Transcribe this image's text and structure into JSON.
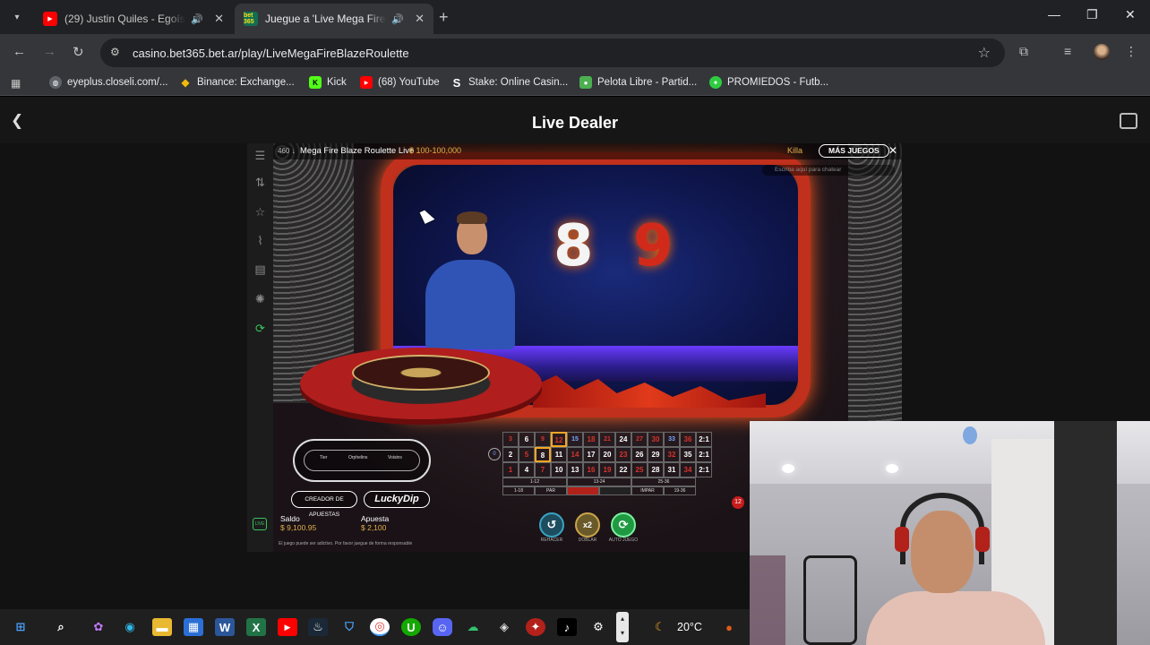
{
  "browser": {
    "tabs": [
      {
        "title": "(29) Justin Quiles - Egoísta (",
        "favicon": "youtube",
        "active": false
      },
      {
        "title": "Juegue a 'Live Mega Fire Bl",
        "favicon": "bet365",
        "favicon_text": "bet 365",
        "active": true
      }
    ],
    "url": "casino.bet365.bet.ar/play/LiveMegaFireBlazeRoulette",
    "bookmarks": [
      {
        "label": "eyeplus.closeli.com/...",
        "icon": "globe",
        "color": "#5f6368"
      },
      {
        "label": "Binance: Exchange...",
        "icon": "binance",
        "color": "#f0b90b"
      },
      {
        "label": "Kick",
        "icon": "kick",
        "icon_text": "K",
        "color": "#53fc18"
      },
      {
        "label": "(68) YouTube",
        "icon": "youtube",
        "color": "#ff0000"
      },
      {
        "label": "Stake: Online Casin...",
        "icon": "stake",
        "icon_text": "S",
        "color": "#1a2c38"
      },
      {
        "label": "Pelota Libre - Partid...",
        "icon": "pelota-libre",
        "color": "#4caf50"
      },
      {
        "label": "PROMIEDOS - Futb...",
        "icon": "promiedos",
        "color": "#2ecc40"
      }
    ]
  },
  "page": {
    "title": "Live Dealer"
  },
  "game": {
    "table_id": "460 ↓",
    "name": "Mega Fire Blaze Roulette Live",
    "limits": "$ 100-100,000",
    "user": "Killa",
    "more_games": "MÁS JUEGOS",
    "chat_placeholder": "Escriba aquí para chatear",
    "fire_numbers": [
      "8",
      "9"
    ],
    "racetrack_labels": [
      "Tier",
      "Orphelins",
      "Voisins"
    ],
    "bet_creator": "CREADOR DE APUESTAS",
    "lucky_dip": "LuckyDip",
    "balance_label": "Saldo",
    "balance": "$ 9,100.95",
    "bet_label": "Apuesta",
    "bet": "$ 2,100",
    "responsible_note": "El juego puede ser adictivo. Por favor juegue de forma responsable",
    "grid_rows": [
      [
        "3",
        "6",
        "9",
        "12",
        "15",
        "18",
        "21",
        "24",
        "27",
        "30",
        "33",
        "36",
        "2:1"
      ],
      [
        "2",
        "5",
        "8",
        "11",
        "14",
        "17",
        "20",
        "23",
        "26",
        "29",
        "32",
        "35",
        "2:1"
      ],
      [
        "1",
        "4",
        "7",
        "10",
        "13",
        "16",
        "19",
        "22",
        "25",
        "28",
        "31",
        "34",
        "2:1"
      ]
    ],
    "outside_dozens": [
      "1-12",
      "13-24",
      "25-36"
    ],
    "outside_bets": [
      "1-18",
      "PAR",
      "",
      "",
      "IMPAR",
      "19-36"
    ],
    "zero": "0",
    "timer": "12",
    "buttons": [
      {
        "label": "REHACER",
        "icon": "undo"
      },
      {
        "label": "DOBLAR",
        "text": "x2"
      },
      {
        "label": "AUTO JUEGO",
        "icon": "autoplay"
      }
    ],
    "live_badge": "LIVE"
  },
  "taskbar": {
    "apps": [
      "start",
      "search",
      "copilot",
      "edge",
      "file-explorer",
      "store",
      "word",
      "excel",
      "youtube",
      "steam",
      "vpn",
      "chrome",
      "upwork",
      "discord",
      "cloud",
      "obs",
      "davinci",
      "tiktok",
      "settings"
    ],
    "temperature": "20°C"
  },
  "colors": {
    "chrome_dark": "#202124",
    "chrome_toolbar": "#35363a",
    "accent_gold": "#e2b04a",
    "roulette_red": "#d8342c",
    "chip_blue": "#7ea6ff"
  }
}
